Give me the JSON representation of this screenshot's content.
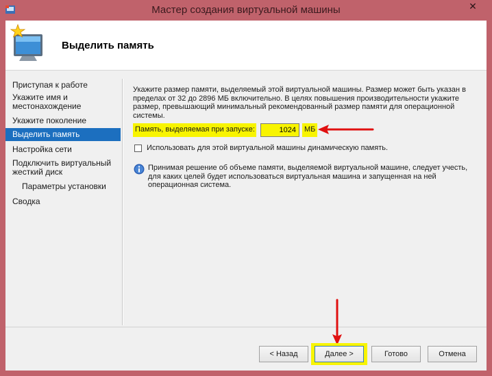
{
  "window": {
    "title": "Мастер создания виртуальной машины",
    "close_glyph": "✕"
  },
  "header": {
    "page_title": "Выделить память"
  },
  "nav": {
    "items": [
      {
        "label": "Приступая к работе",
        "active": false
      },
      {
        "label": "Укажите имя и местонахождение",
        "active": false
      },
      {
        "label": "Укажите поколение",
        "active": false
      },
      {
        "label": "Выделить память",
        "active": true
      },
      {
        "label": "Настройка сети",
        "active": false
      },
      {
        "label": "Подключить виртуальный жесткий диск",
        "active": false
      },
      {
        "label": "Параметры установки",
        "active": false
      },
      {
        "label": "Сводка",
        "active": false
      }
    ]
  },
  "main": {
    "description": "Укажите размер памяти, выделяемый этой виртуальной машины. Размер может быть указан в пределах от 32 до 2896 МБ включительно. В целях повышения производительности укажите размер, превышающий минимальный рекомендованный размер памяти для операционной системы.",
    "memory_label": "Память, выделяемая при запуске:",
    "memory_value": "1024",
    "memory_unit": "МБ",
    "dynamic_memory_label": "Использовать для этой виртуальной машины динамическую память.",
    "dynamic_memory_checked": false,
    "info_text": "Принимая решение об объеме памяти, выделяемой виртуальной машине, следует учесть, для каких целей будет использоваться виртуальная машина и запущенная на ней операционная система."
  },
  "footer": {
    "back_label": "< Назад",
    "next_label": "Далее >",
    "finish_label": "Готово",
    "cancel_label": "Отмена"
  },
  "colors": {
    "title_bar": "#c0626b",
    "highlight": "#f8f400",
    "nav_active": "#1c6fbf",
    "annotation_arrow": "#e01010"
  },
  "icons": {
    "app": "hyperv-app-icon",
    "wizard": "monitor-star-icon",
    "info": "info-icon",
    "close": "close-icon"
  }
}
